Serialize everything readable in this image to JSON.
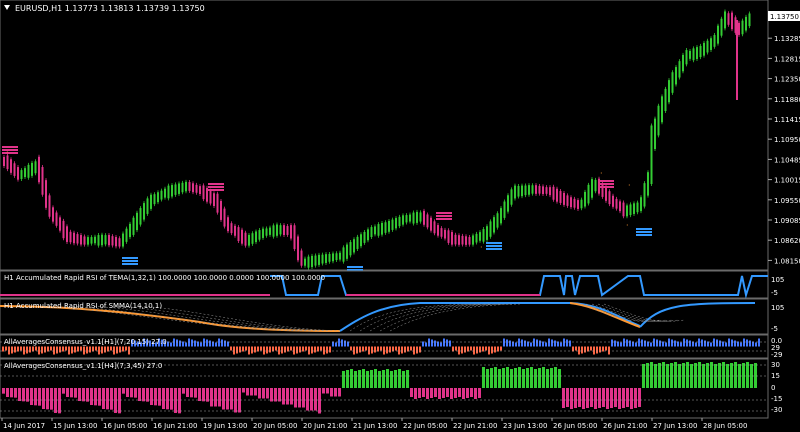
{
  "colors": {
    "background": "#000000",
    "bull": "#33CC33",
    "bear": "#E0338A",
    "blue": "#3399FF",
    "orange": "#FF9933",
    "text": "#FFFFFF",
    "grid": "#6A6A6A",
    "price_box": "#FFFFFF"
  },
  "main_panel": {
    "title": "EURUSD,H1  1.13773 1.13813 1.13739 1.13750",
    "price_ticks": [
      "1.13750",
      "1.13285",
      "1.12815",
      "1.12350",
      "1.11880",
      "1.11415",
      "1.10950",
      "1.10485",
      "1.10015",
      "1.09550",
      "1.09085",
      "1.08620",
      "1.08150"
    ],
    "current_price": "1.13750",
    "top_price": "1.13806"
  },
  "panels": [
    {
      "title": "H1 Accumulated Rapid RSI of TEMA(1,32,1) 100.0000 100.0000 0.0000 100.0000 100.0000",
      "axis": [
        "105",
        "-5"
      ]
    },
    {
      "title": "H1 Accumulated Rapid RSI of SMMA(14,10,1)",
      "axis": [
        "105",
        "-5"
      ]
    },
    {
      "title": "AllAveragesConsensus_v1.1[H1](7,20,15) 27.0",
      "axis": [
        "0.0",
        "29",
        "-29"
      ]
    },
    {
      "title": "AllAveragesConsensus_v1.1[H4](7,3,45) 27.0",
      "axis": [
        "30",
        "15",
        "0",
        "-15",
        "-30"
      ]
    }
  ],
  "time_axis": [
    "14 Jun 2017",
    "15 Jun 13:00",
    "16 Jun 05:00",
    "16 Jun 21:00",
    "19 Jun 13:00",
    "20 Jun 05:00",
    "20 Jun 21:00",
    "21 Jun 13:00",
    "22 Jun 05:00",
    "22 Jun 21:00",
    "23 Jun 13:00",
    "26 Jun 05:00",
    "26 Jun 21:00",
    "27 Jun 13:00",
    "28 Jun 05:00"
  ],
  "icons": {
    "menu": "triangle-down-icon"
  }
}
